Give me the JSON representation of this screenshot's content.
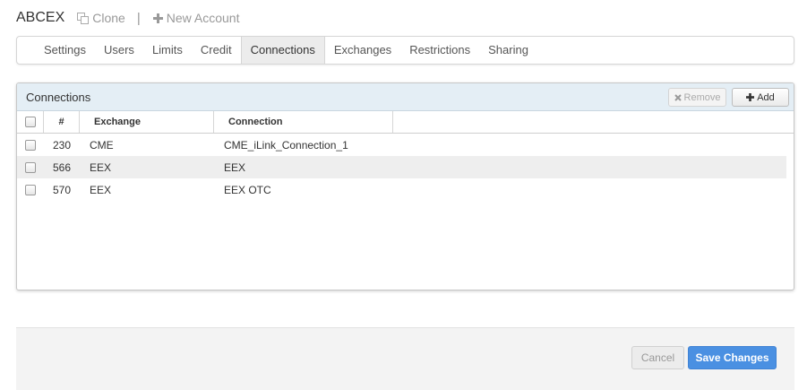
{
  "header": {
    "account_name": "ABCEX",
    "clone_label": "Clone",
    "separator": "|",
    "new_account_label": "New Account"
  },
  "tabs": [
    {
      "label": "Settings"
    },
    {
      "label": "Users"
    },
    {
      "label": "Limits"
    },
    {
      "label": "Credit"
    },
    {
      "label": "Connections",
      "active": true
    },
    {
      "label": "Exchanges"
    },
    {
      "label": "Restrictions"
    },
    {
      "label": "Sharing"
    }
  ],
  "panel": {
    "title": "Connections",
    "remove_label": "Remove",
    "add_label": "Add",
    "columns": {
      "num": "#",
      "exchange": "Exchange",
      "connection": "Connection"
    },
    "rows": [
      {
        "num": "230",
        "exchange": "CME",
        "connection": "CME_iLink_Connection_1"
      },
      {
        "num": "566",
        "exchange": "EEX",
        "connection": "EEX"
      },
      {
        "num": "570",
        "exchange": "EEX",
        "connection": "EEX OTC"
      }
    ]
  },
  "footer": {
    "cancel_label": "Cancel",
    "save_label": "Save Changes"
  },
  "colors": {
    "accent": "#4a90e2",
    "panel_header": "#e4eef5",
    "row_alt": "#eeeeee"
  },
  "icons": {
    "clone": "copy-icon",
    "new_account": "plus-icon",
    "remove": "x-icon",
    "add": "plus-icon"
  }
}
